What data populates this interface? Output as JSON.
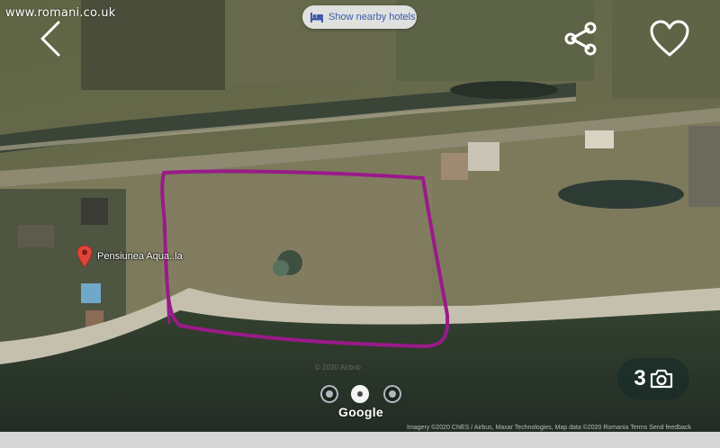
{
  "site": {
    "watermark": "www.romani.co.uk"
  },
  "top_bar": {
    "back_icon": "chevron-left-icon",
    "hotels_button_label": "Show nearby hotels",
    "hotels_icon": "bed-icon",
    "share_icon": "share-icon",
    "favorite_icon": "heart-outline-icon"
  },
  "map": {
    "place_pin_label": "Pensiunea Aqua..la",
    "place_pin_icon": "map-pin-icon",
    "faint_watermark": "© 2020 Airbnb",
    "annotation_color": "#9a1a8a"
  },
  "gallery": {
    "dot_count": 3,
    "active_dot_index": 1,
    "provider": "Google",
    "photo_count": "3",
    "camera_icon": "camera-icon",
    "attribution": "Imagery ©2020 CNES / Airbus, Maxar Technologies, Map data ©2020   Romania   Terms   Send feedback"
  },
  "colors": {
    "water": "#2c3a2e",
    "land": "#7a7558",
    "chip_text": "#3c5aa8"
  }
}
